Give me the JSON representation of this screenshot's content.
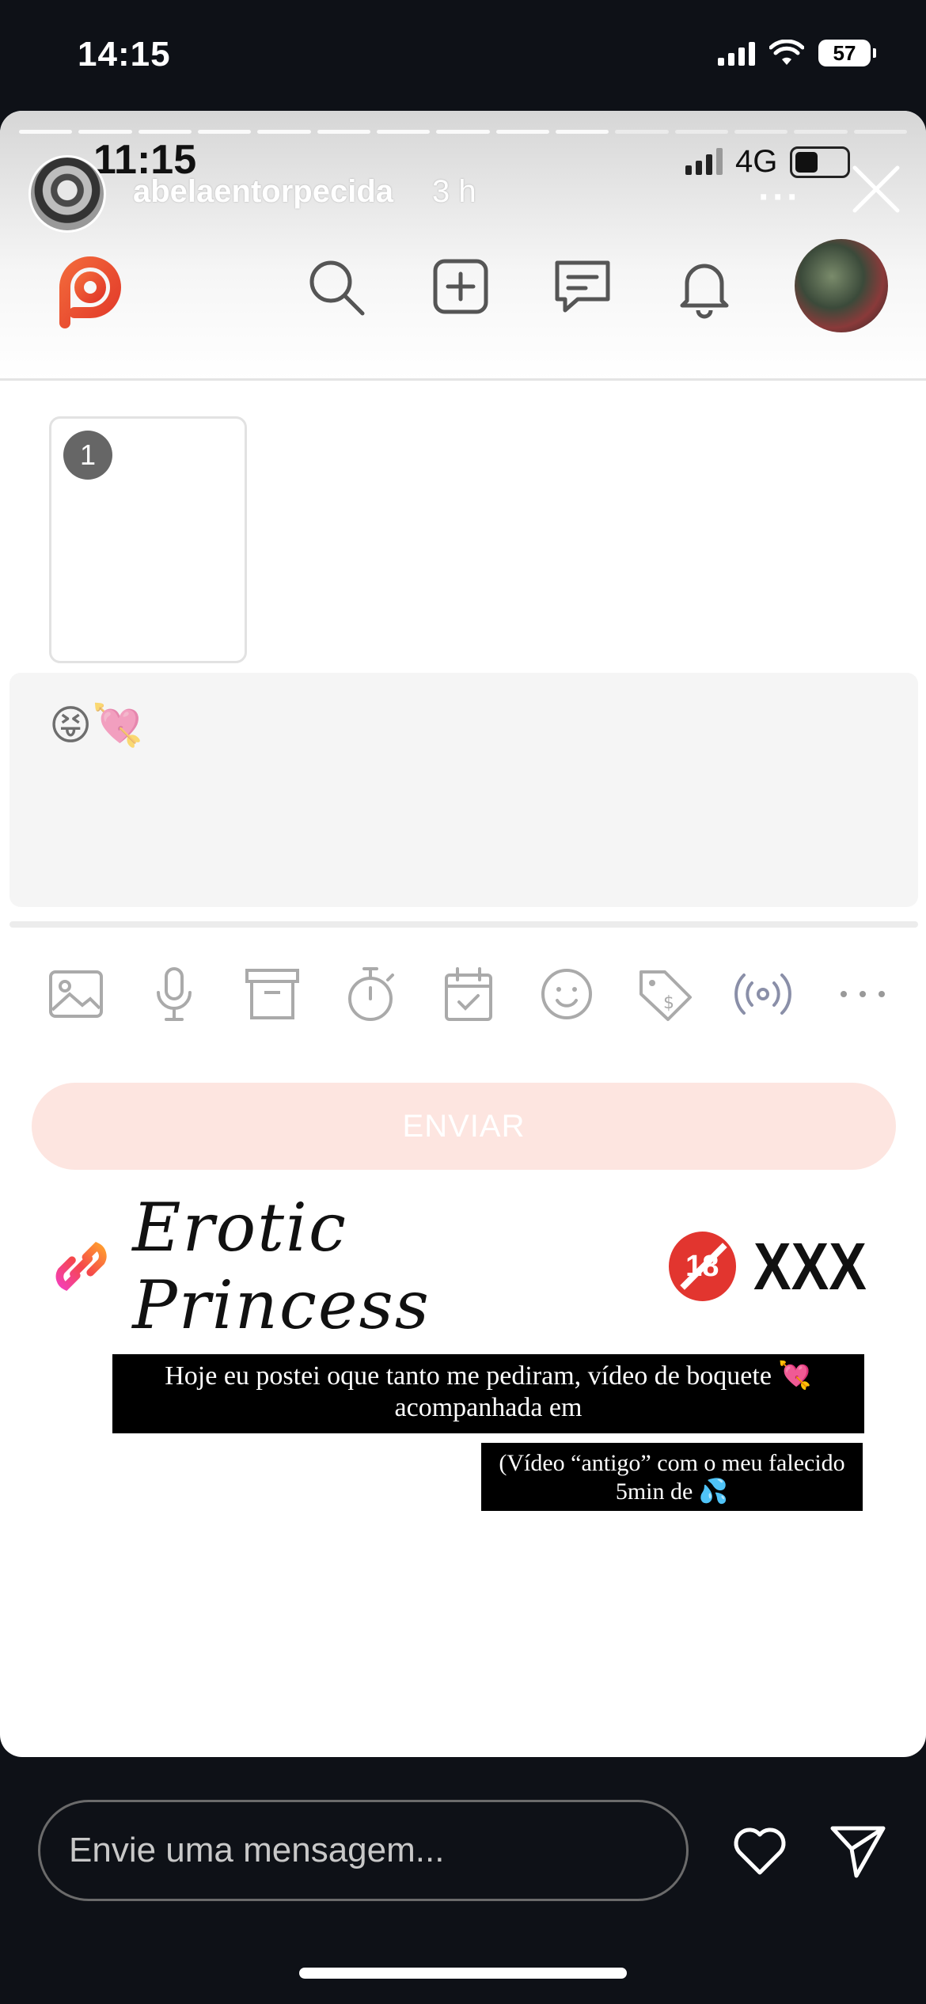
{
  "device_status": {
    "time": "14:15",
    "battery": "57"
  },
  "story": {
    "username": "abelaentorpecida",
    "age": "3 h",
    "inner_status": {
      "time": "11:15",
      "network": "4G"
    }
  },
  "composer": {
    "thumbnail_index": "1",
    "text_emoji": "😝💘",
    "send_label": "ENVIAR",
    "tools": [
      "image-icon",
      "microphone-icon",
      "archive-icon",
      "timer-icon",
      "calendar-icon",
      "smiley-icon",
      "price-tag-icon",
      "broadcast-icon",
      "more-icon"
    ]
  },
  "overlay": {
    "title": "Erotic Princess",
    "tag": "XXX",
    "caption_1": "Hoje eu postei oque tanto me pediram, vídeo de boquete 💘 acompanhada em",
    "caption_2": "(Vídeo “antigo” com o meu falecido 5min de 💦"
  },
  "reply": {
    "placeholder": "Envie uma mensagem..."
  },
  "colors": {
    "accent": "#e8452c",
    "send_button": "#fde5e0"
  }
}
